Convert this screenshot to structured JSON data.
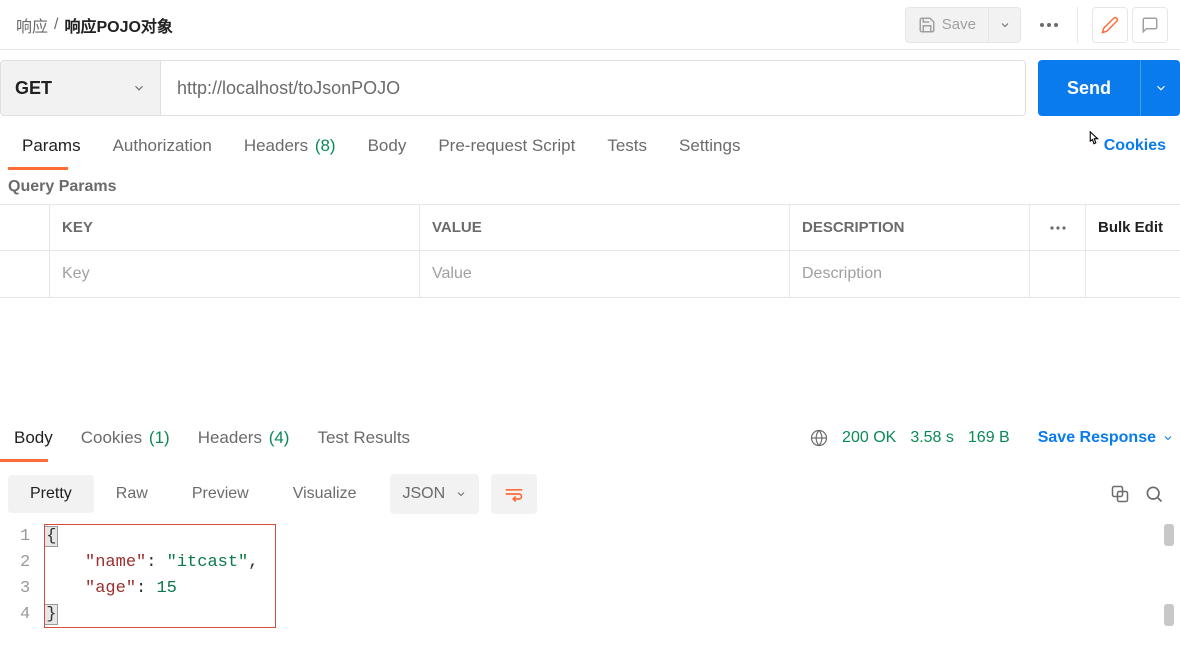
{
  "breadcrumb": {
    "parent": "响应",
    "current": "响应POJO对象"
  },
  "toolbar": {
    "save": "Save"
  },
  "request": {
    "method": "GET",
    "url": "http://localhost/toJsonPOJO",
    "send": "Send"
  },
  "req_tabs": {
    "params": "Params",
    "authorization": "Authorization",
    "headers": "Headers",
    "headers_count": "(8)",
    "body": "Body",
    "prerequest": "Pre-request Script",
    "tests": "Tests",
    "settings": "Settings",
    "cookies": "Cookies"
  },
  "section": {
    "query_params": "Query Params"
  },
  "table": {
    "head": {
      "key": "KEY",
      "value": "VALUE",
      "desc": "DESCRIPTION",
      "bulk": "Bulk Edit"
    },
    "placeholder": {
      "key": "Key",
      "value": "Value",
      "desc": "Description"
    }
  },
  "resp_tabs": {
    "body": "Body",
    "cookies": "Cookies",
    "cookies_count": "(1)",
    "headers": "Headers",
    "headers_count": "(4)",
    "test_results": "Test Results"
  },
  "status": {
    "code": "200 OK",
    "time": "3.58 s",
    "size": "169 B",
    "save_response": "Save Response"
  },
  "view": {
    "pretty": "Pretty",
    "raw": "Raw",
    "preview": "Preview",
    "visualize": "Visualize",
    "format": "JSON"
  },
  "code_lines": {
    "l1": "1",
    "l2": "2",
    "l3": "3",
    "l4": "4"
  },
  "json_body": {
    "open": "{",
    "key1": "\"name\"",
    "col1": ": ",
    "val1": "\"itcast\"",
    "comma": ",",
    "key2": "\"age\"",
    "col2": ": ",
    "val2": "15",
    "close": "}"
  }
}
